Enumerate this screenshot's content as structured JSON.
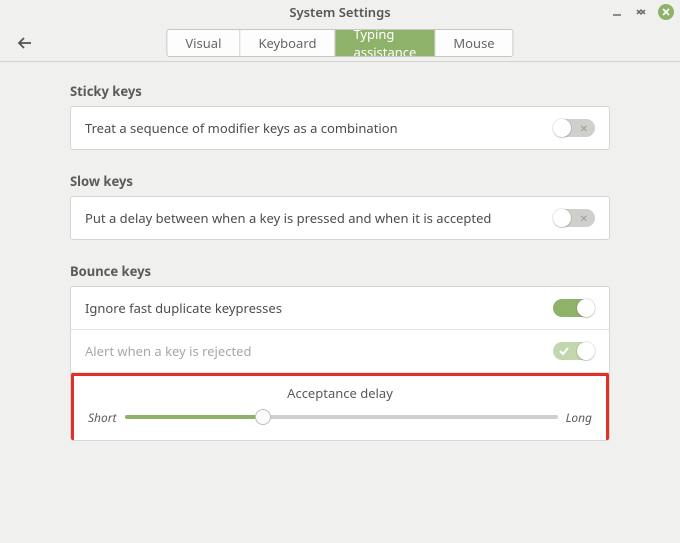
{
  "window": {
    "title": "System Settings"
  },
  "tabs": [
    {
      "label": "Visual",
      "active": false
    },
    {
      "label": "Keyboard",
      "active": false
    },
    {
      "label": "Typing assistance",
      "active": true
    },
    {
      "label": "Mouse",
      "active": false
    }
  ],
  "sections": {
    "sticky": {
      "title": "Sticky keys",
      "row0": {
        "label": "Treat a sequence of modifier keys as a combination",
        "on": false
      }
    },
    "slow": {
      "title": "Slow keys",
      "row0": {
        "label": "Put a delay between when a key is pressed and when it is accepted",
        "on": false
      }
    },
    "bounce": {
      "title": "Bounce keys",
      "row0": {
        "label": "Ignore fast duplicate keypresses",
        "on": true
      },
      "row1": {
        "label": "Alert when a key is rejected",
        "on": true,
        "disabled": true
      },
      "slider": {
        "title": "Acceptance delay",
        "min_label": "Short",
        "max_label": "Long",
        "value_percent": 32
      }
    }
  }
}
